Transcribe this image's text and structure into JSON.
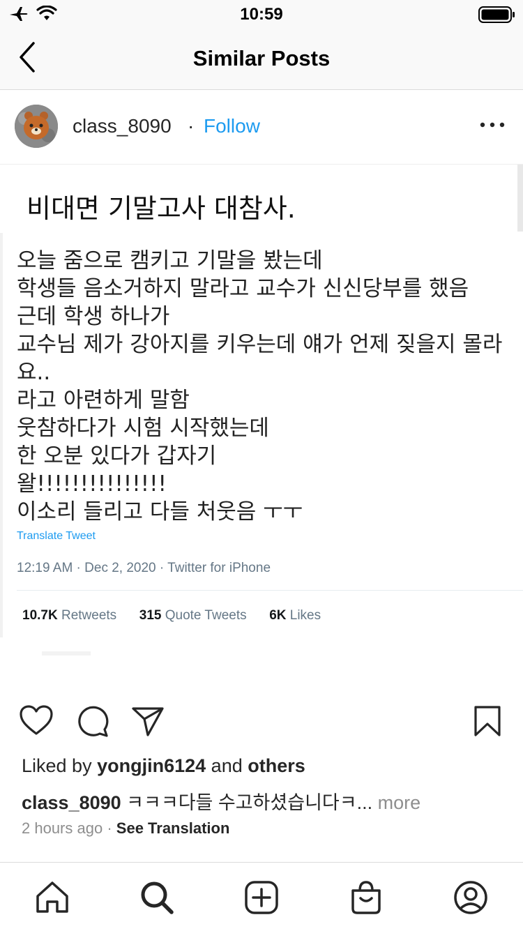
{
  "status_bar": {
    "time": "10:59",
    "icons": [
      "airplane-icon",
      "wifi-icon",
      "battery-icon"
    ]
  },
  "nav": {
    "title": "Similar Posts",
    "back_icon": "chevron-left-icon"
  },
  "post": {
    "username": "class_8090",
    "separator": "·",
    "follow_label": "Follow",
    "more_icon": "more-horizontal-icon",
    "image": {
      "title": "비대면 기말고사 대참사.",
      "tweet_lines": [
        "오늘 줌으로 캠키고 기말을 봤는데",
        "학생들 음소거하지 말라고 교수가 신신당부를 했음",
        "근데 학생 하나가",
        "교수님 제가 강아지를 키우는데 얘가 언제 짖을지 몰라",
        "요..",
        "라고 아련하게 말함",
        "웃참하다가 시험 시작했는데",
        "한 오분 있다가 갑자기",
        "왈!!!!!!!!!!!!!!!",
        "이소리 들리고 다들 처웃음 ㅜㅜ"
      ],
      "translate_label": "Translate Tweet",
      "meta": "12:19 AM · Dec 2, 2020 · Twitter for iPhone",
      "stats": {
        "retweets_count": "10.7K",
        "retweets_label": "Retweets",
        "quotes_count": "315",
        "quotes_label": "Quote Tweets",
        "likes_count": "6K",
        "likes_label": "Likes"
      }
    },
    "actions": [
      "heart-icon",
      "comment-icon",
      "share-icon",
      "bookmark-icon"
    ],
    "liked_by": {
      "prefix": "Liked by",
      "user": "yongjin6124",
      "and": "and",
      "others": "others"
    },
    "caption": {
      "user": "class_8090",
      "text": "ㅋㅋㅋ다들 수고하셨습니다ㅋ...",
      "more": "more"
    },
    "time_ago": "2 hours ago",
    "meta_separator": "·",
    "see_translation": "See Translation"
  },
  "tab_bar": {
    "items": [
      "home-icon",
      "search-icon",
      "add-post-icon",
      "shop-icon",
      "profile-icon"
    ]
  }
}
